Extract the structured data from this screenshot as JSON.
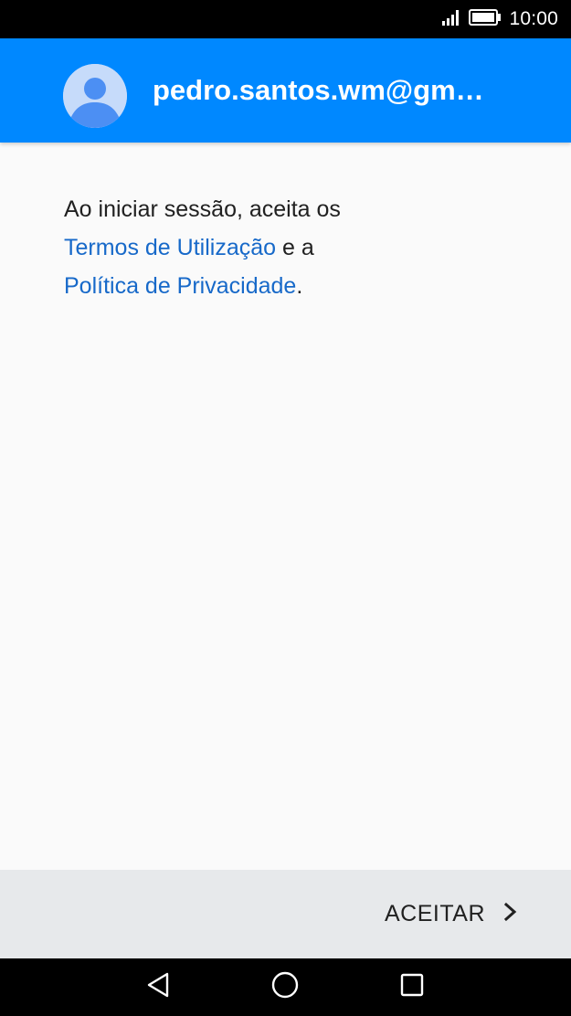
{
  "status_bar": {
    "time": "10:00",
    "icons": [
      "signal-icon",
      "battery-icon"
    ]
  },
  "header": {
    "account_email": "pedro.santos.wm@gm…",
    "avatar_icon": "account-circle-icon",
    "background_color": "#0088ff"
  },
  "content": {
    "line1": "Ao iniciar sessão, aceita os",
    "terms_link": "Termos de Utilização",
    "connector": " e a",
    "privacy_link": "Política de Privacidade",
    "period": ".",
    "link_color": "#1769c9"
  },
  "action_bar": {
    "accept_label": "ACEITAR",
    "accept_icon": "chevron-right-icon"
  },
  "nav_bar": {
    "buttons": [
      "back-icon",
      "home-icon",
      "recents-icon"
    ]
  }
}
